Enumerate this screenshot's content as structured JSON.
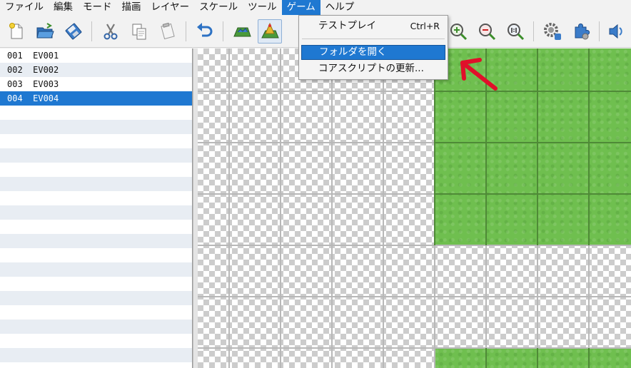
{
  "menu": {
    "file": "ファイル",
    "edit": "編集",
    "mode": "モード",
    "draw": "描画",
    "layer": "レイヤー",
    "scale": "スケール",
    "tools": "ツール",
    "game": "ゲーム",
    "help": "ヘルプ"
  },
  "toolbar": {
    "icons": [
      "new-file-icon",
      "open-folder-icon",
      "save-disk-icon",
      "cut-scissors-icon",
      "copy-icon",
      "paste-icon",
      "undo-icon",
      "map-layer-icon",
      "event-layer-icon",
      "zoom-in-icon",
      "zoom-out-icon",
      "zoom-actual-icon",
      "settings-gear-icon",
      "plugin-puzzle-icon",
      "sound-speaker-icon"
    ],
    "pressed": "event-layer-icon"
  },
  "game_menu": {
    "test_play": "テストプレイ",
    "test_play_shortcut": "Ctrl+R",
    "open_folder": "フォルダを開く",
    "update_core_script": "コアスクリプトの更新..."
  },
  "events": [
    {
      "label": "001  EV001"
    },
    {
      "label": "002  EV002"
    },
    {
      "label": "003  EV003"
    },
    {
      "label": "004  EV004"
    }
  ],
  "selected_event": "004  EV004",
  "colors": {
    "accent": "#1f78d1",
    "grass": "#6fbf4f",
    "annotation": "#e0102a",
    "row_alt": "#e8edf3"
  }
}
